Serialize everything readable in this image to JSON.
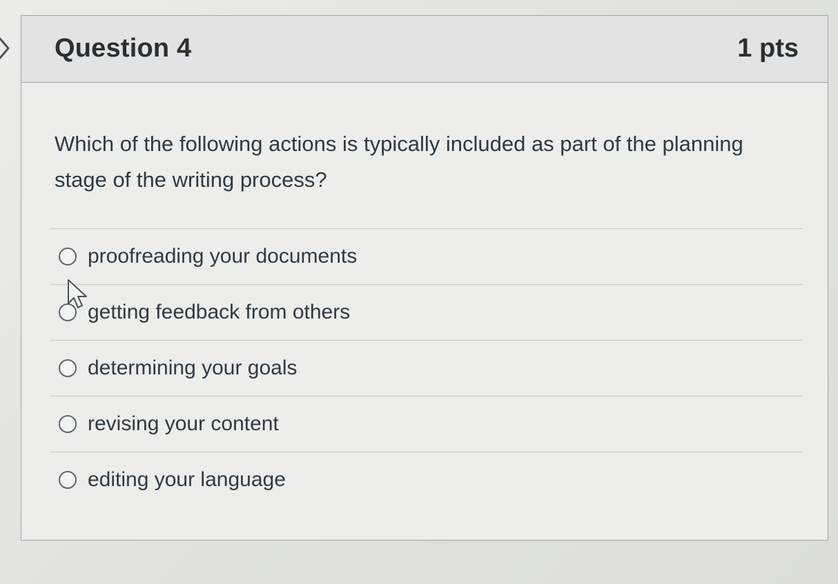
{
  "question": {
    "title": "Question 4",
    "points": "1 pts",
    "text": "Which of the following actions is typically included as part of the planning stage of the writing process?"
  },
  "answers": [
    {
      "label": "proofreading your documents",
      "selected": false
    },
    {
      "label": "getting feedback from others",
      "selected": false
    },
    {
      "label": "determining your goals",
      "selected": false
    },
    {
      "label": "revising your content",
      "selected": false
    },
    {
      "label": "editing your language",
      "selected": false
    }
  ],
  "icons": {
    "expand": "chevron-right-icon",
    "pointer": "mouse-cursor-icon",
    "radio": "radio-button-icon"
  },
  "colors": {
    "text": "#2d3b45",
    "border": "#9ea3a6",
    "header_bg": "#e2e3e2"
  }
}
